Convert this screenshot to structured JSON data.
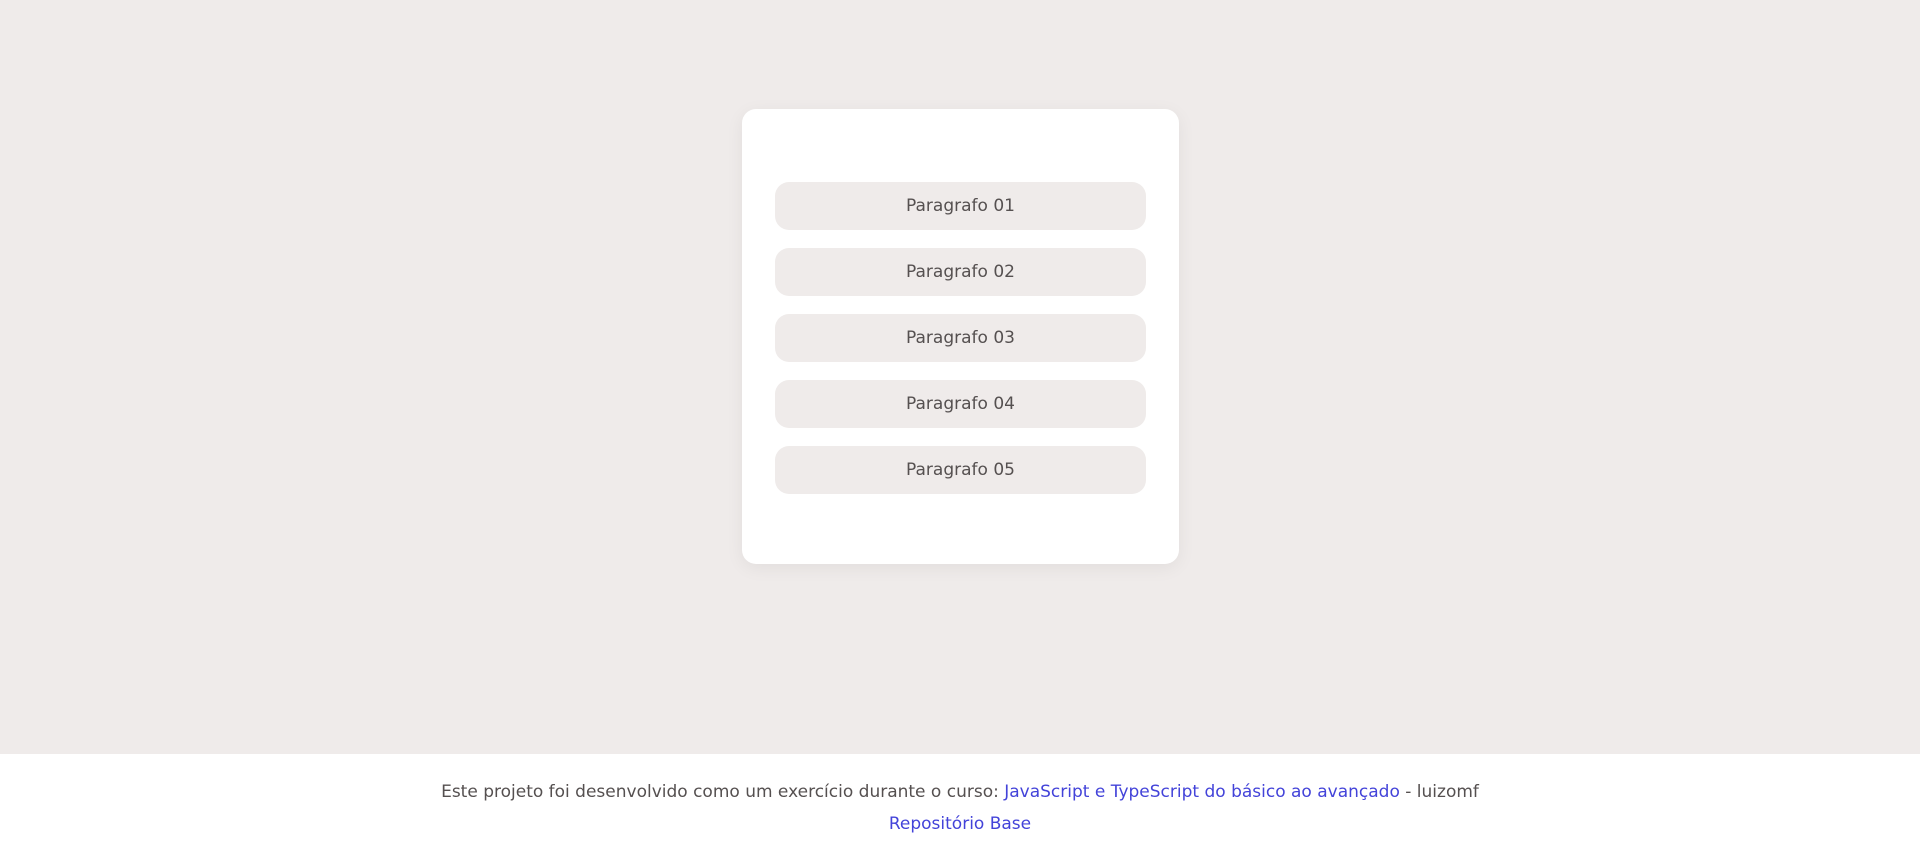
{
  "card": {
    "paragraphs": [
      "Paragrafo 01",
      "Paragrafo 02",
      "Paragrafo 03",
      "Paragrafo 04",
      "Paragrafo 05"
    ]
  },
  "footer": {
    "intro_text": "Este projeto foi desenvolvido como um exercício durante o curso: ",
    "course_link": "JavaScript e TypeScript do básico ao avançado",
    "author_text": " - luizomf",
    "repo_link": "Repositório Base"
  },
  "colors": {
    "background": "#efebea",
    "card": "#ffffff",
    "text": "#555050",
    "link": "#4343d9"
  }
}
